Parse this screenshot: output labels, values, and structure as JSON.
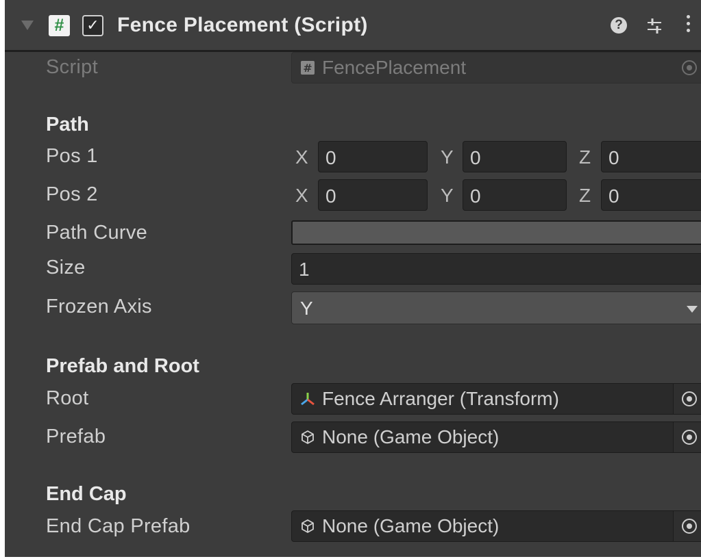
{
  "component": {
    "title": "Fence Placement (Script)",
    "script_icon_glyph": "#",
    "enabled_glyph": "✓",
    "help_glyph": "?"
  },
  "fields": {
    "script": {
      "label": "Script",
      "value": "FencePlacement"
    },
    "path_header": "Path",
    "pos1": {
      "label": "Pos 1",
      "x_label": "X",
      "x": "0",
      "y_label": "Y",
      "y": "0",
      "z_label": "Z",
      "z": "0"
    },
    "pos2": {
      "label": "Pos 2",
      "x_label": "X",
      "x": "0",
      "y_label": "Y",
      "y": "0",
      "z_label": "Z",
      "z": "0"
    },
    "path_curve": {
      "label": "Path Curve"
    },
    "size": {
      "label": "Size",
      "value": "1"
    },
    "frozen_axis": {
      "label": "Frozen Axis",
      "value": "Y"
    },
    "prefab_header": "Prefab and Root",
    "root": {
      "label": "Root",
      "value": "Fence Arranger (Transform)"
    },
    "prefab": {
      "label": "Prefab",
      "value": "None (Game Object)"
    },
    "end_cap_header": "End Cap",
    "end_cap_prefab": {
      "label": "End Cap Prefab",
      "value": "None (Game Object)"
    }
  },
  "icons": {
    "foldout": "triangle-down-icon",
    "script": "csharp-script-icon",
    "transform": "transform-axes-icon",
    "gameobject": "cube-icon",
    "picker": "object-picker-icon",
    "presets": "sliders-icon",
    "menu": "kebab-menu-icon"
  },
  "colors": {
    "background": "#3c3c3c",
    "field": "#2a2a2a",
    "script_icon_green": "#2f8f45"
  }
}
